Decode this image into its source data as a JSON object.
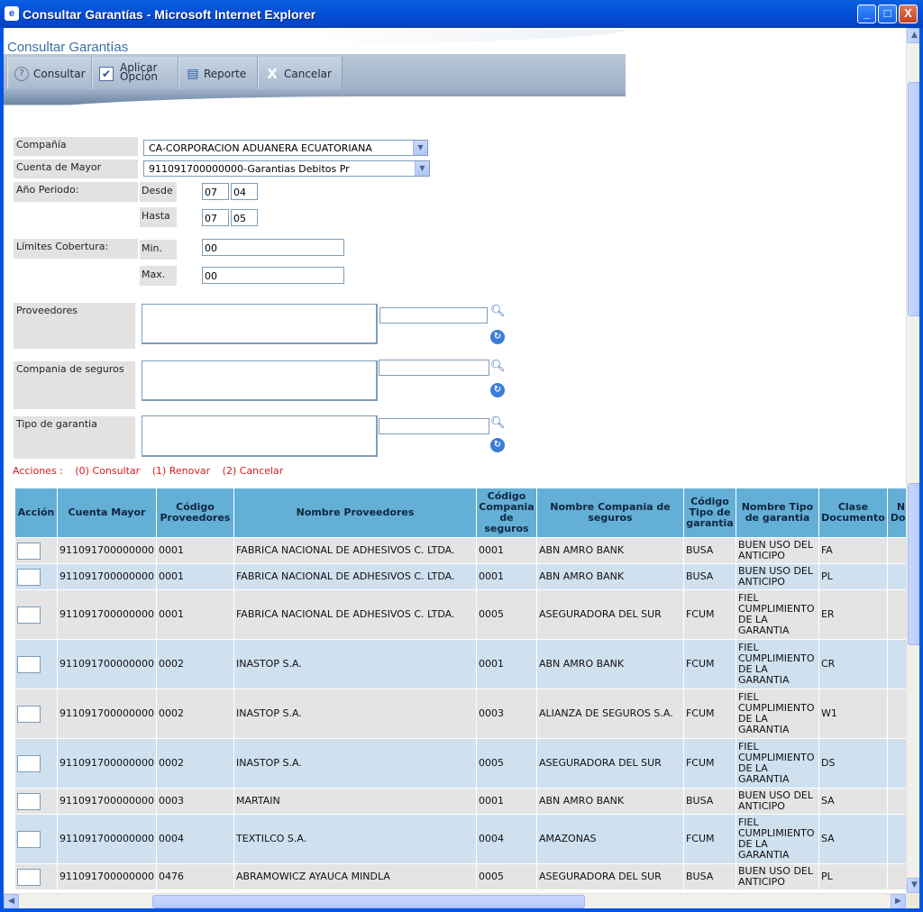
{
  "window": {
    "title": "Consultar Garantías - Microsoft Internet Explorer",
    "minimize": "_",
    "maximize": "□",
    "close": "X"
  },
  "page": {
    "title": "Consultar Garantías"
  },
  "toolbar": {
    "consultar": "Consultar",
    "aplicar_line1": "Aplicar",
    "aplicar_line2": "Opción",
    "reporte": "Reporte",
    "cancelar": "Cancelar"
  },
  "form": {
    "compania_label": "Compañía",
    "compania_value": "CA-CORPORACION ADUANERA ECUATORIANA",
    "cuenta_label": "Cuenta de Mayor",
    "cuenta_value": "911091700000000-Garantias Debitos Pr",
    "anio_label": "Año Periodo:",
    "desde_label": "Desde",
    "desde_year": "07",
    "desde_month": "04",
    "hasta_label": "Hasta",
    "hasta_year": "07",
    "hasta_month": "05",
    "limites_label": "Límites Cobertura:",
    "min_label": "Min.",
    "min_value": "00",
    "max_label": "Max.",
    "max_value": "00",
    "proveedores_label": "Proveedores",
    "compania_seguros_label": "Compania de seguros",
    "tipo_garantia_label": "Tipo de garantia"
  },
  "acciones": {
    "label": "Acciones :",
    "consultar": "(0) Consultar",
    "renovar": "(1) Renovar",
    "cancelar": "(2) Cancelar"
  },
  "table": {
    "headers": [
      "Acción",
      "Cuenta Mayor",
      "Código Proveedores",
      "Nombre Proveedores",
      "Código Compania de seguros",
      "Nombre Compania de seguros",
      "Código Tipo de garantia",
      "Nombre Tipo de garantia",
      "Clase Documento",
      "N Doc"
    ],
    "rows": [
      {
        "cuenta": "911091700000000",
        "cod_prov": "0001",
        "nombre_prov": "FABRICA NACIONAL DE ADHESIVOS C. LTDA.",
        "cod_cia": "0001",
        "nombre_cia": "ABN AMRO BANK",
        "cod_tipo": "BUSA",
        "nombre_tipo": "BUEN USO DEL ANTICIPO",
        "clase": "FA"
      },
      {
        "cuenta": "911091700000000",
        "cod_prov": "0001",
        "nombre_prov": "FABRICA NACIONAL DE ADHESIVOS C. LTDA.",
        "cod_cia": "0001",
        "nombre_cia": "ABN AMRO BANK",
        "cod_tipo": "BUSA",
        "nombre_tipo": "BUEN USO DEL ANTICIPO",
        "clase": "PL"
      },
      {
        "cuenta": "911091700000000",
        "cod_prov": "0001",
        "nombre_prov": "FABRICA NACIONAL DE ADHESIVOS C. LTDA.",
        "cod_cia": "0005",
        "nombre_cia": "ASEGURADORA DEL SUR",
        "cod_tipo": "FCUM",
        "nombre_tipo": "FIEL CUMPLIMIENTO DE LA GARANTIA",
        "clase": "ER"
      },
      {
        "cuenta": "911091700000000",
        "cod_prov": "0002",
        "nombre_prov": "INASTOP S.A.",
        "cod_cia": "0001",
        "nombre_cia": "ABN AMRO BANK",
        "cod_tipo": "FCUM",
        "nombre_tipo": "FIEL CUMPLIMIENTO DE LA GARANTIA",
        "clase": "CR"
      },
      {
        "cuenta": "911091700000000",
        "cod_prov": "0002",
        "nombre_prov": "INASTOP S.A.",
        "cod_cia": "0003",
        "nombre_cia": "ALIANZA DE SEGUROS S.A.",
        "cod_tipo": "FCUM",
        "nombre_tipo": "FIEL CUMPLIMIENTO DE LA GARANTIA",
        "clase": "W1"
      },
      {
        "cuenta": "911091700000000",
        "cod_prov": "0002",
        "nombre_prov": "INASTOP S.A.",
        "cod_cia": "0005",
        "nombre_cia": "ASEGURADORA DEL SUR",
        "cod_tipo": "FCUM",
        "nombre_tipo": "FIEL CUMPLIMIENTO DE LA GARANTIA",
        "clase": "DS"
      },
      {
        "cuenta": "911091700000000",
        "cod_prov": "0003",
        "nombre_prov": "MARTAIN",
        "cod_cia": "0001",
        "nombre_cia": "ABN AMRO BANK",
        "cod_tipo": "BUSA",
        "nombre_tipo": "BUEN USO DEL ANTICIPO",
        "clase": "SA"
      },
      {
        "cuenta": "911091700000000",
        "cod_prov": "0004",
        "nombre_prov": "TEXTILCO S.A.",
        "cod_cia": "0004",
        "nombre_cia": "AMAZONAS",
        "cod_tipo": "FCUM",
        "nombre_tipo": "FIEL CUMPLIMIENTO DE LA GARANTIA",
        "clase": "SA"
      },
      {
        "cuenta": "911091700000000",
        "cod_prov": "0476",
        "nombre_prov": "ABRAMOWICZ AYAUCA MINDLA",
        "cod_cia": "0005",
        "nombre_cia": "ASEGURADORA DEL SUR",
        "cod_tipo": "BUSA",
        "nombre_tipo": "BUEN USO DEL ANTICIPO",
        "clase": "PL"
      }
    ]
  },
  "colors": {
    "title_blue": "#3f6fa5",
    "header_blue": "#64afd6",
    "row_grey": "#e4e4e4",
    "row_blue": "#cfe0ef",
    "accion_red": "#d41c1c"
  }
}
